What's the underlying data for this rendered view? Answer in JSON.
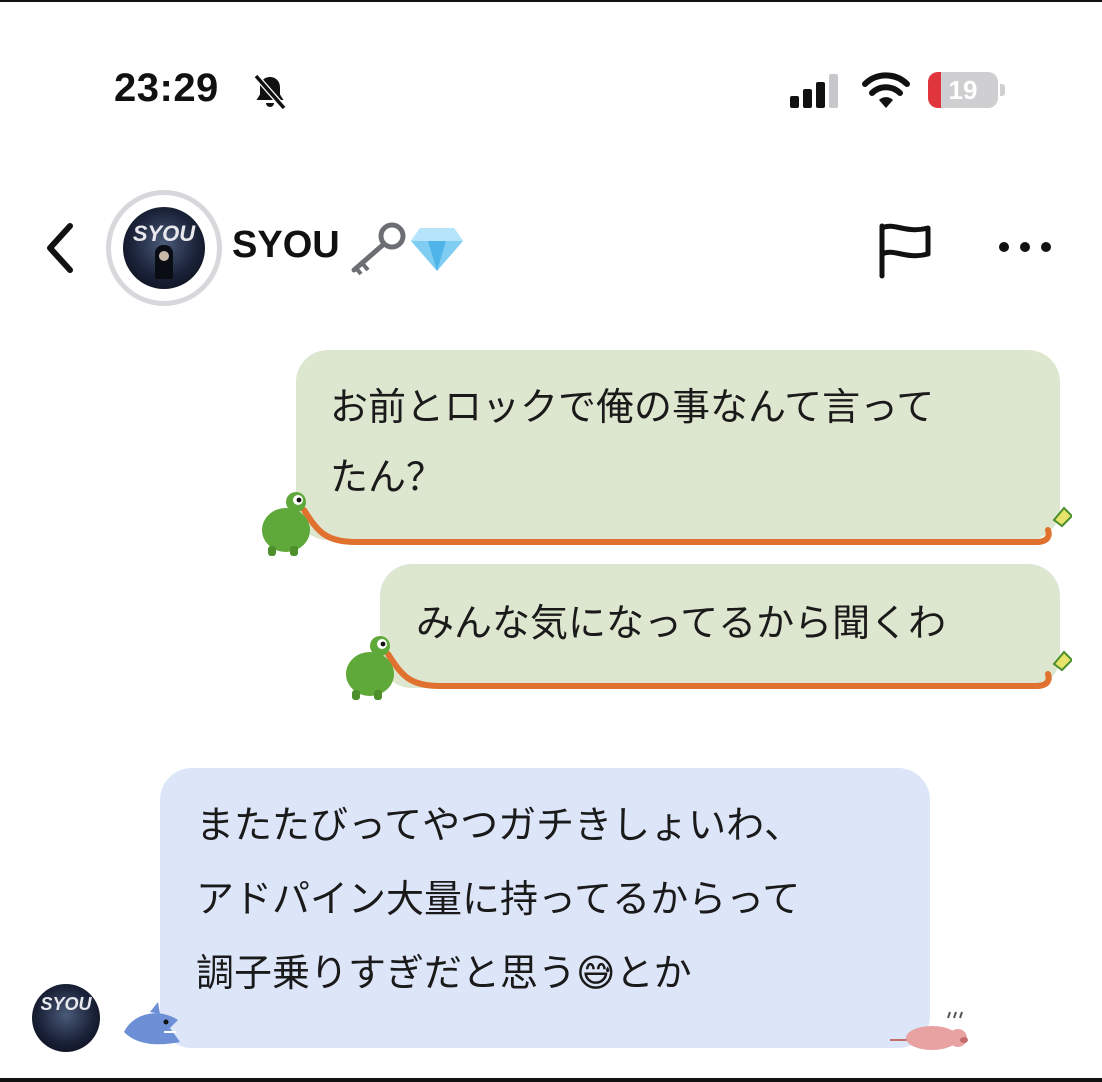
{
  "status_bar": {
    "time": "23:29",
    "battery_level": "19",
    "battery_fraction": 0.19,
    "icons": [
      "bell-slash-icon",
      "cellular-signal-icon",
      "wifi-icon",
      "battery-icon"
    ]
  },
  "header": {
    "contact_name": "SYOU",
    "avatar_text": "SYOU",
    "name_emojis": [
      "key-emoji",
      "gem-emoji"
    ],
    "icons": [
      "back-chevron-icon",
      "flag-icon",
      "more-icon"
    ]
  },
  "messages": [
    {
      "direction": "outgoing",
      "lines": [
        "お前とロックで俺の事なんて言って",
        "たん？"
      ]
    },
    {
      "direction": "outgoing",
      "lines": [
        "みんな気になってるから聞くわ"
      ]
    },
    {
      "direction": "incoming",
      "lines": [
        "またたびってやつガチきしょいわ、",
        "アドパイン大量に持ってるからって",
        "調子乗りすぎだと思う"
      ],
      "trailing_emoji": "😅",
      "trailing_text": "とか"
    }
  ],
  "colors": {
    "outgoing_bubble": "#dde6cf",
    "incoming_bubble": "#dde5f8",
    "frog_green": "#5fa83a",
    "tongue_orange": "#e0712f",
    "battery_red": "#e0353c"
  }
}
